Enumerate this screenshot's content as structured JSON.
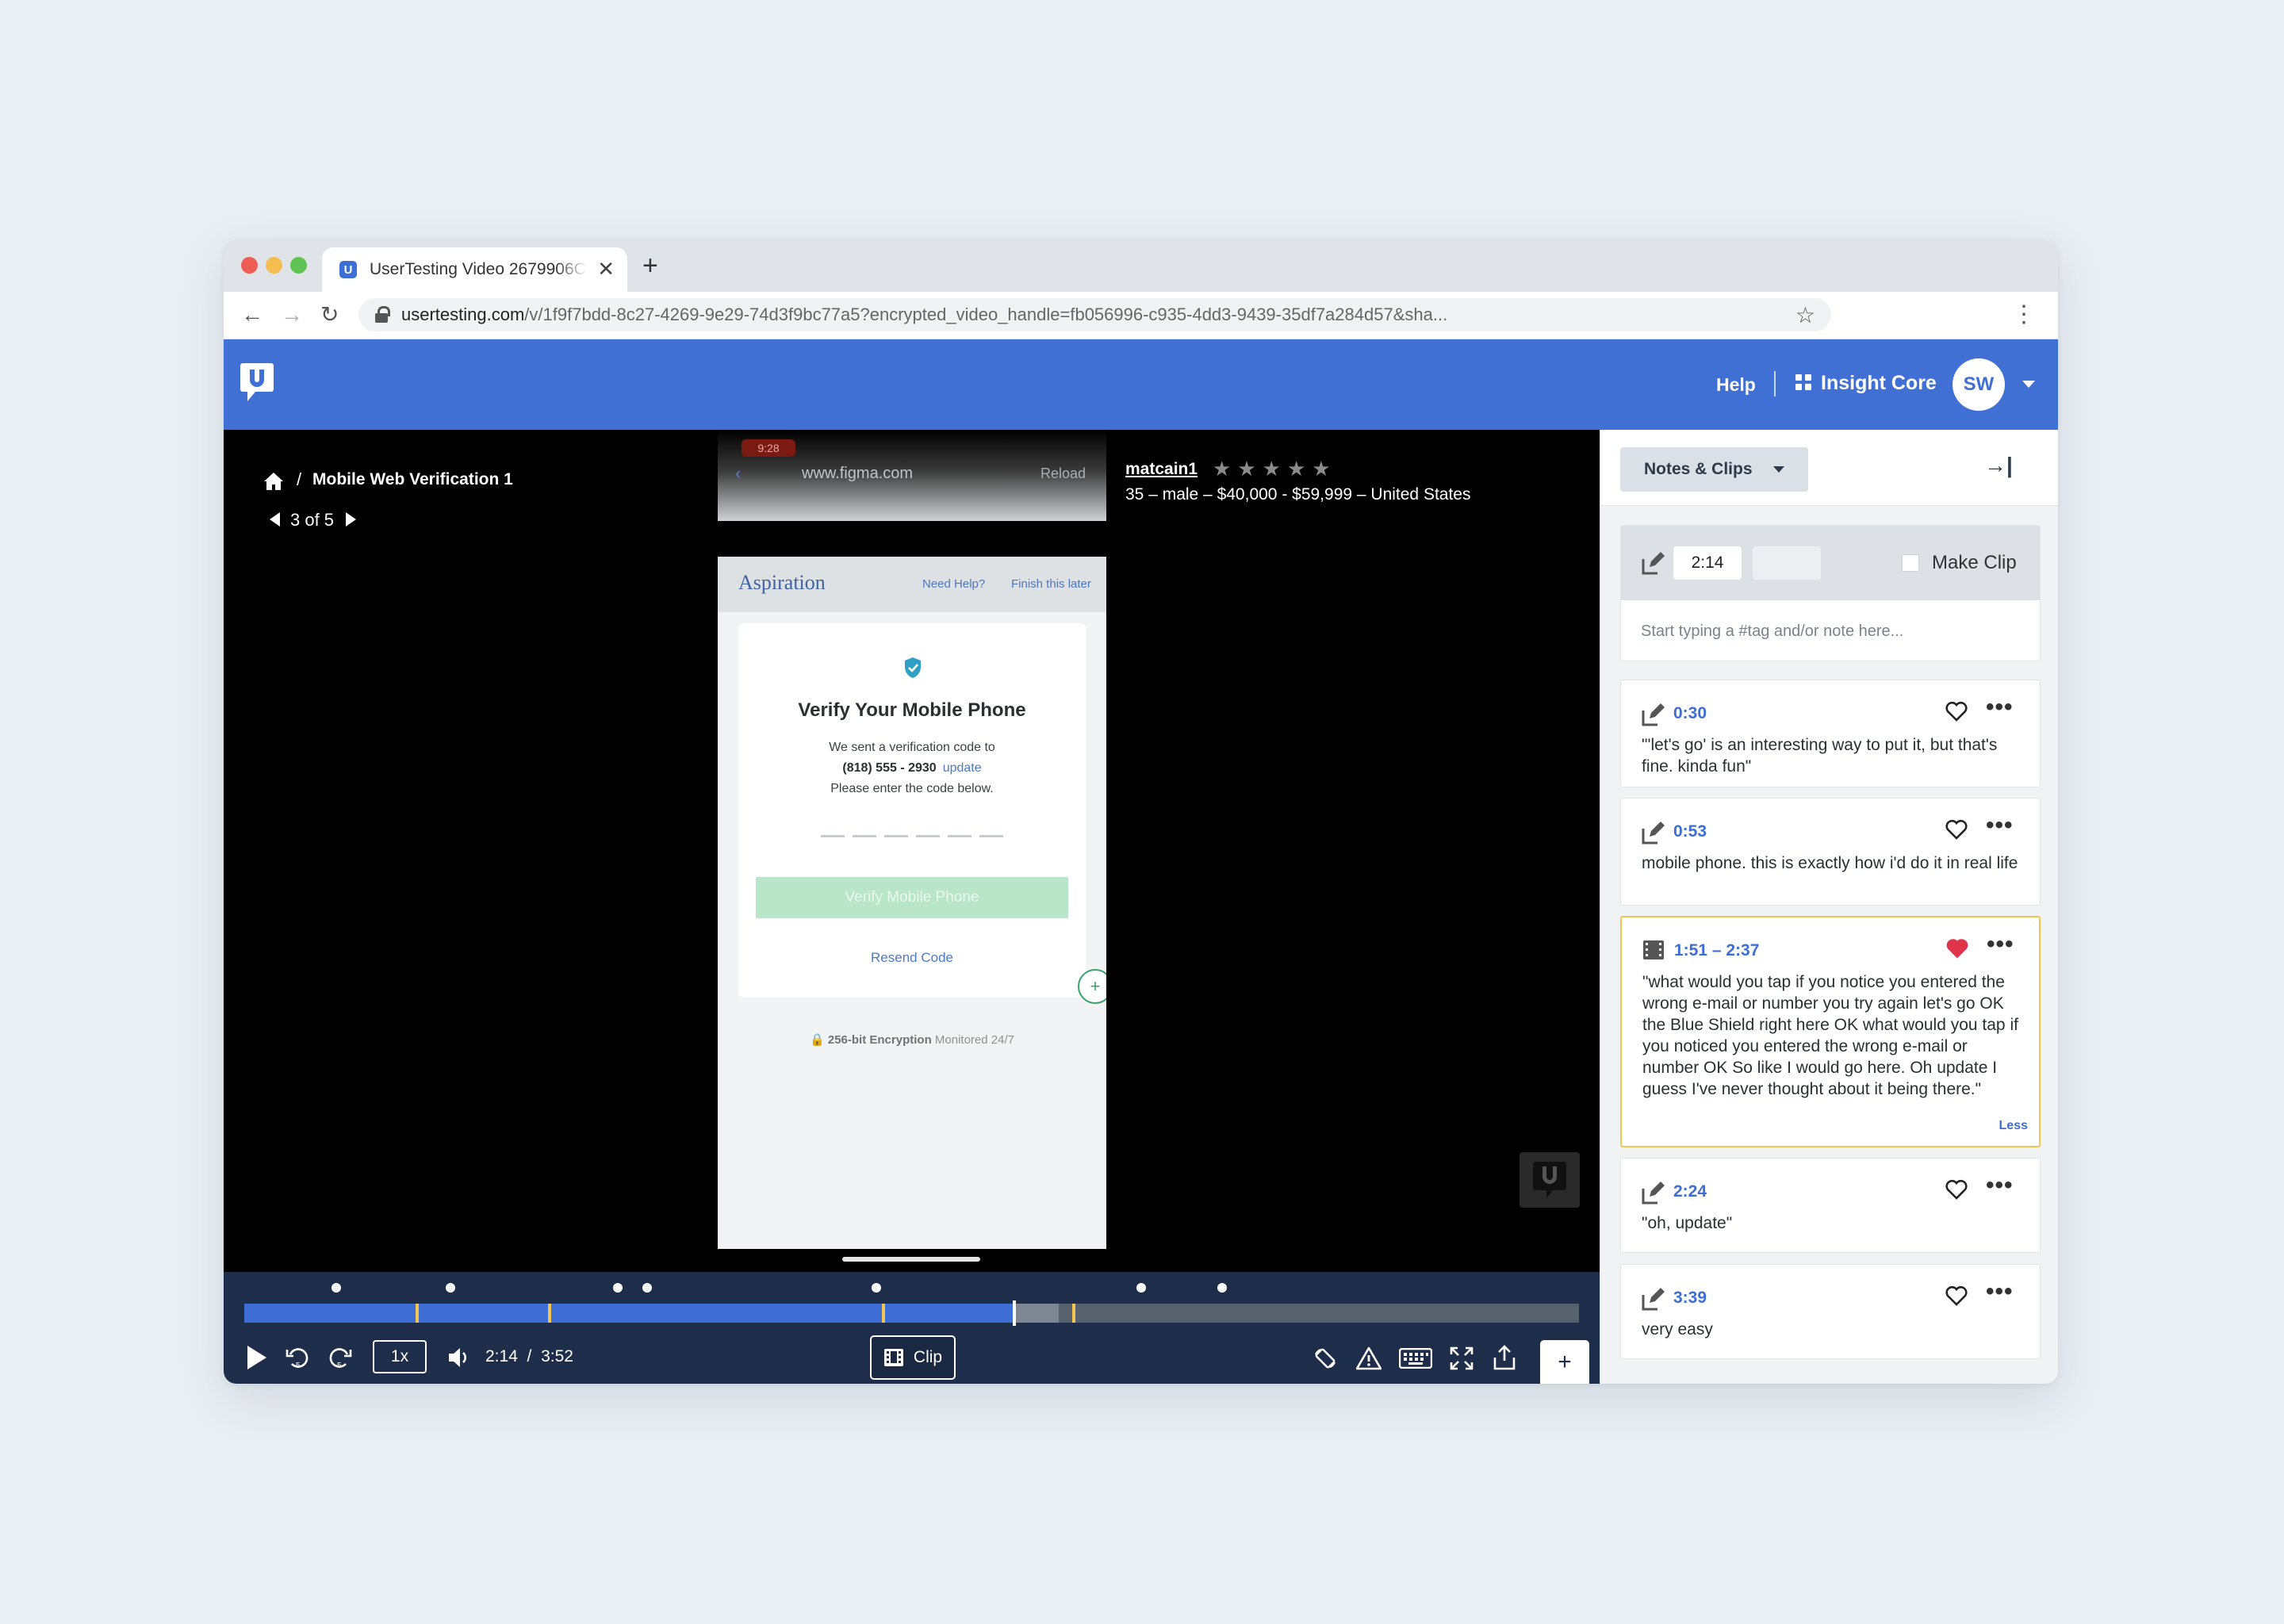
{
  "browser": {
    "tab_title": "UserTesting Video 2679906C",
    "tab_favicon": "U",
    "url_host": "usertesting.com",
    "url_path": "/v/1f9f7bdd-8c27-4269-9e29-74d3f9bc77a5?encrypted_video_handle=fb056996-c935-4dd3-9439-35df7a284d57&sha..."
  },
  "header": {
    "help": "Help",
    "insight_core": "Insight Core",
    "avatar": "SW",
    "brand_color": "#4170d4"
  },
  "breadcrumb": {
    "title": "Mobile Web Verification 1",
    "separator": "/",
    "pager": "3 of 5"
  },
  "tester": {
    "name": "matcain1",
    "rating_stars": [
      "★",
      "★",
      "★",
      "★",
      "★"
    ],
    "demographics": "35 – male – $40,000 - $59,999 – United States"
  },
  "phone": {
    "status_time": "9:28",
    "browser_url": "www.figma.com",
    "reload": "Reload",
    "brand": "Aspiration",
    "need_help": "Need Help?",
    "finish_later": "Finish this later",
    "title": "Verify Your Mobile Phone",
    "sent_text": "We sent a verification code to",
    "phone_number": "(818) 555 - 2930",
    "update_link": "update",
    "enter_text": "Please enter the code below.",
    "verify_button": "Verify Mobile Phone",
    "resend": "Resend Code",
    "encryption_bold": "256-bit Encryption",
    "encryption_rest": "Monitored 24/7"
  },
  "player": {
    "speed": "1x",
    "current_time": "2:14",
    "time_separator": "/",
    "duration": "3:52",
    "clip_label": "Clip",
    "add_label": "+",
    "progress_played": 0.577,
    "progress_buffered": 0.61
  },
  "panel": {
    "dropdown_label": "Notes & Clips",
    "collapse_icon": "→|",
    "composer": {
      "time": "2:14",
      "make_clip": "Make Clip",
      "placeholder": "Start typing a #tag and/or note here..."
    },
    "notes": [
      {
        "time": "0:30",
        "text": "\"'let's go' is an interesting way to put it, but that's fine. kinda fun\"",
        "liked": false
      },
      {
        "time": "0:53",
        "text": "mobile phone. this is exactly how i'd do it in real life",
        "liked": false
      },
      {
        "time": "1:51 – 2:37",
        "text": "\"what would you tap if you notice you entered the wrong e-mail or number you try again let's go OK the Blue Shield right here OK what would you tap if you noticed you entered the wrong e-mail or number OK So like I would go here. Oh update I guess I've never thought about it being there.\"",
        "liked": true,
        "less": "Less"
      },
      {
        "time": "2:24",
        "text": "\"oh, update\"",
        "liked": false
      },
      {
        "time": "3:39",
        "text": "very easy",
        "liked": false
      }
    ]
  },
  "colors": {
    "accent": "#3e6ed4",
    "highlight": "#f2c451",
    "heart_liked": "#e0344a",
    "player_bg": "#1e2e4a"
  }
}
